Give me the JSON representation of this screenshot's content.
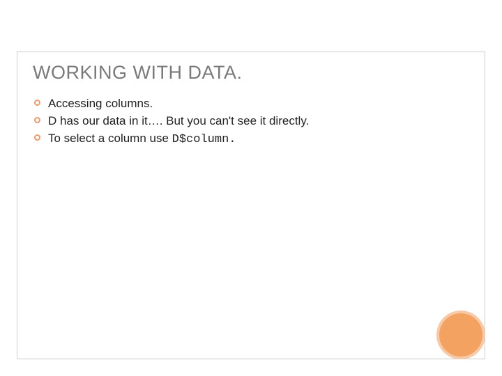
{
  "slide": {
    "title": "WORKING WITH DATA.",
    "bullets": [
      {
        "text": "Accessing columns."
      },
      {
        "text": "D has our data in it…. But you can't see it directly."
      },
      {
        "prefix": "To select a column use ",
        "code": "D$column."
      }
    ],
    "colors": {
      "bullet_ring": "#e89a6a",
      "accent_circle_fill": "#f4a261",
      "accent_circle_ring": "#f6c9a8",
      "title_color": "#7a7a7a",
      "frame_border": "#cccccc"
    }
  }
}
